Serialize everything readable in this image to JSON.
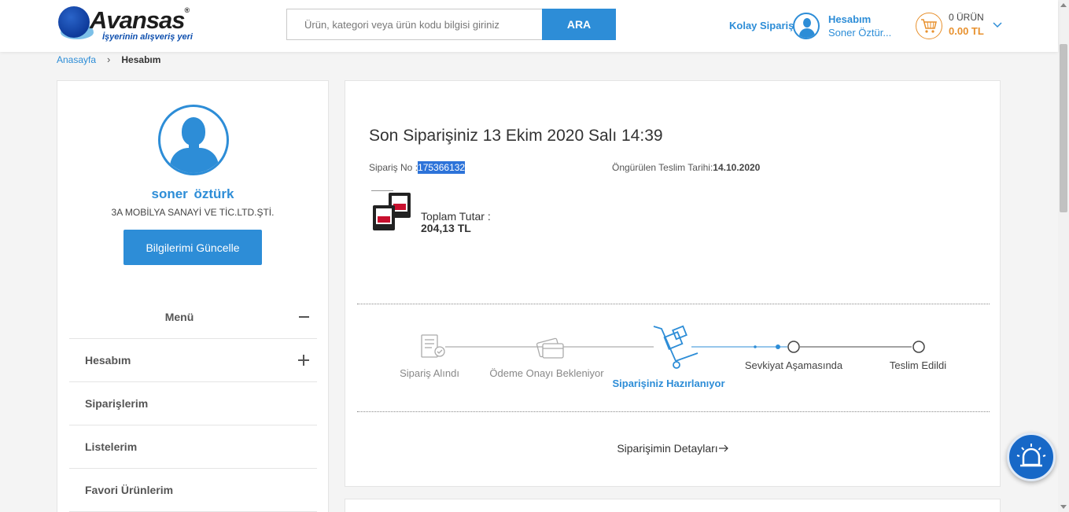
{
  "header": {
    "logo_text": "Avansas",
    "logo_tagline": "İşyerinin alışveriş yeri",
    "search_placeholder": "Ürün, kategori veya ürün kodu bilgisi giriniz",
    "search_button": "ARA",
    "kolay_siparis": "Kolay Sipariş",
    "account_title": "Hesabım",
    "account_name": "Soner Öztür...",
    "cart_count": "0 ÜRÜN",
    "cart_total": "0.00 TL"
  },
  "breadcrumb": {
    "home": "Anasayfa",
    "separator": "›",
    "current": "Hesabım"
  },
  "sidebar": {
    "user_name": "soner  öztürk",
    "company": "3A MOBİLYA SANAYİ VE TİC.LTD.ŞTİ.",
    "update_button": "Bilgilerimi Güncelle",
    "menu_title": "Menü",
    "menu_items": [
      {
        "label": "Hesabım",
        "expandable": true
      },
      {
        "label": "Siparişlerim",
        "expandable": false
      },
      {
        "label": "Listelerim",
        "expandable": false
      },
      {
        "label": "Favori Ürünlerim",
        "expandable": false
      }
    ]
  },
  "order": {
    "title": "Son Siparişiniz 13 Ekim 2020 Salı 14:39",
    "order_no_label": "Sipariş No :",
    "order_no": "175366132",
    "delivery_label": "Öngürülen Teslim Tarihi:",
    "delivery_date": "14.10.2020",
    "total_label": "Toplam Tutar :",
    "total_value": "204,13 TL",
    "steps": [
      {
        "label": "Sipariş Alındı",
        "state": "done"
      },
      {
        "label": "Ödeme Onayı Bekleniyor",
        "state": "done"
      },
      {
        "label": "Siparişiniz Hazırlanıyor",
        "state": "active"
      },
      {
        "label": "Sevkiyat Aşamasında",
        "state": "pending"
      },
      {
        "label": "Teslim Edildi",
        "state": "pending"
      }
    ],
    "details_link": "Siparişimin Detayları"
  },
  "colors": {
    "brand_blue": "#2d8dd7",
    "cart_orange": "#e8912e",
    "highlight": "#2d73d9"
  },
  "icons": {
    "account": "user-icon",
    "cart": "cart-icon",
    "notify": "bell-alert-icon"
  }
}
